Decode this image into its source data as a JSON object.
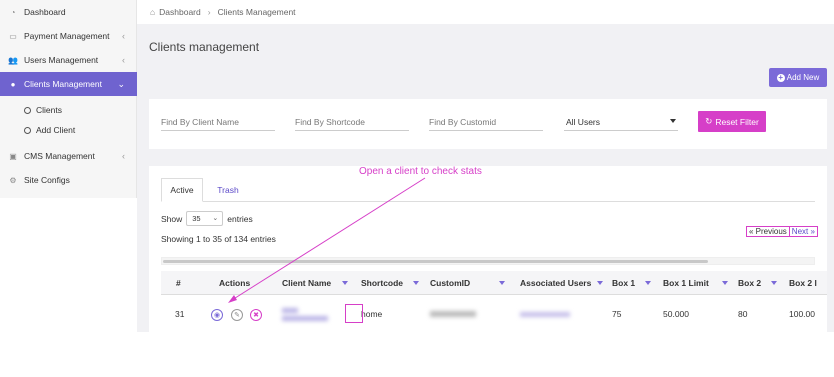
{
  "sidebar": {
    "items": [
      {
        "label": "Dashboard",
        "icon": "dashboard-icon"
      },
      {
        "label": "Payment Management",
        "icon": "payment-icon"
      },
      {
        "label": "Users Management",
        "icon": "users-icon"
      },
      {
        "label": "Clients Management",
        "icon": "user-icon"
      },
      {
        "label": "CMS Management",
        "icon": "monitor-icon"
      },
      {
        "label": "Site Configs",
        "icon": "gear-icon"
      }
    ],
    "sub_items": [
      {
        "label": "Clients"
      },
      {
        "label": "Add Client"
      }
    ]
  },
  "breadcrumb": {
    "home": "Dashboard",
    "current": "Clients Management"
  },
  "page": {
    "title": "Clients management",
    "add_button": "Add New"
  },
  "filters": {
    "client_name_placeholder": "Find By Client Name",
    "shortcode_placeholder": "Find By Shortcode",
    "customid_placeholder": "Find By Customid",
    "users_select": "All Users",
    "reset_button": "Reset Filter"
  },
  "tabs": [
    {
      "label": "Active"
    },
    {
      "label": "Trash"
    }
  ],
  "table_controls": {
    "show_label": "Show",
    "length_value": "35",
    "entries_label": "entries",
    "info": "Showing 1 to 35 of 134 entries",
    "previous": "« Previous",
    "next": "Next »"
  },
  "table": {
    "columns": [
      "#",
      "Actions",
      "Client Name",
      "Shortcode",
      "CustomID",
      "Associated Users",
      "Box 1",
      "Box 1 Limit",
      "Box 2",
      "Box 2 l"
    ],
    "row": {
      "id": "31",
      "client_name": " ",
      "shortcode": "home",
      "customid": " ",
      "associated_users": " ",
      "box1": "75",
      "box1_limit": "50.000",
      "box2": "80",
      "box2_limit": "100.00"
    }
  },
  "annotation": "Open a client to check stats",
  "colors": {
    "accent": "#6f63cf",
    "magenta": "#d63fc8",
    "link": "#5a48c8"
  }
}
